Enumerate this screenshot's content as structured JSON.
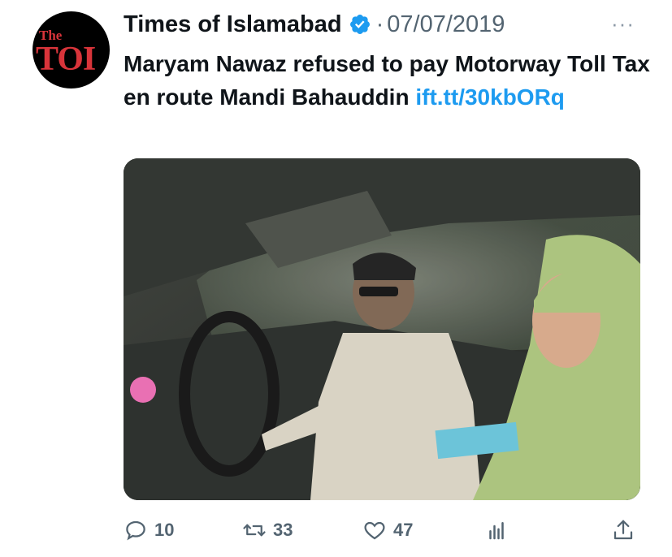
{
  "tweet": {
    "author_name": "Times of Islamabad",
    "separator": "·",
    "date": "07/07/2019",
    "more_label": "···",
    "body_text": "Maryam Nawaz refused to pay Motorway Toll Tax en route Mandi Bahauddin ",
    "link_text": "ift.tt/30kbORq",
    "avatar": {
      "small_text": "The",
      "big_text": "TOI"
    }
  },
  "actions": {
    "replies": "10",
    "retweets": "33",
    "likes": "47"
  },
  "icons": {
    "reply": "reply-icon",
    "retweet": "retweet-icon",
    "like": "heart-icon",
    "views": "analytics-icon",
    "share": "share-icon",
    "verified": "verified-badge-icon"
  },
  "colors": {
    "link": "#1d9bf0",
    "muted": "#536471",
    "avatar_bg": "#000000",
    "avatar_text": "#d8343a"
  }
}
